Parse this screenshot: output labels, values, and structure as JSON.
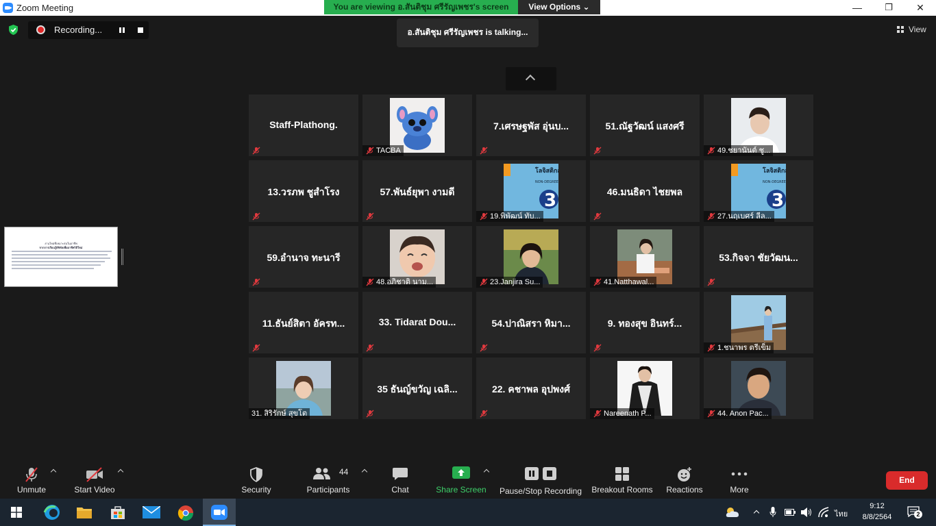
{
  "window": {
    "title": "Zoom Meeting",
    "minimize": "—",
    "restore": "❐",
    "close": "✕"
  },
  "share_banner": {
    "text": "You are viewing อ.สันติชุม ศรีรัญเพชร's screen",
    "view_options": "View Options ⌄"
  },
  "recording": {
    "label": "Recording..."
  },
  "talking": {
    "text": "อ.สันติชุม ศรีรัญเพชร is  talking..."
  },
  "view": {
    "label": "View"
  },
  "shared_screen": {
    "title_line1": "งานใหม่ที่เหมาะสมในอาชีพ",
    "title_line2": "จากการเรียนรู้ดิจิทัลเพื่ออาชีพวิถีใหม่"
  },
  "participants": [
    {
      "name": "Staff-Plathong.",
      "video": false
    },
    {
      "name": "TACBA",
      "video": true,
      "photo": "stitch-plush"
    },
    {
      "name": "7.เศรษฐพัส อุ่นบ...",
      "video": false
    },
    {
      "name": "51.ณัฐวัฒน์ แสงศรี",
      "video": false
    },
    {
      "name": "49.ชยานันต์ ชู...",
      "video": true,
      "photo": "person-white"
    },
    {
      "name": "13.วรภพ ชูสำโรง",
      "video": false
    },
    {
      "name": "57.พันธ์ยุพา งามดี",
      "video": false
    },
    {
      "name": "19.พิพัฒน์ ทับ...",
      "video": true,
      "photo": "course-banner"
    },
    {
      "name": "46.มนธิดา  ไชยพล",
      "video": false
    },
    {
      "name": "27.นฤเบศร์ ลีล...",
      "video": true,
      "photo": "course-banner"
    },
    {
      "name": "59.อำนาจ ทะนารี",
      "video": false
    },
    {
      "name": "48.อภิชาติ นาม...",
      "video": true,
      "photo": "baby"
    },
    {
      "name": "23.Janjira Su...",
      "video": true,
      "photo": "woman-trees"
    },
    {
      "name": "41.Natthawal...",
      "video": true,
      "photo": "woman-sofa"
    },
    {
      "name": "53.กิจจา ชัยวัฒน...",
      "video": false
    },
    {
      "name": "11.ธันย์สิตา อัครท...",
      "video": false
    },
    {
      "name": "33. Tidarat   Dou...",
      "video": false
    },
    {
      "name": "54.ปาณิสรา หิมา...",
      "video": false
    },
    {
      "name": "9. ทองสุข อินทร์...",
      "video": false
    },
    {
      "name": "1.ชนาพร  ตรีเข็ม",
      "video": true,
      "photo": "woman-bridge"
    },
    {
      "name": "31. สิริรักษ์ สุขโต",
      "video": true,
      "photo": "woman-road",
      "muted": false
    },
    {
      "name": "35 ธันญ์ขวัญ เฉลิ...",
      "video": false
    },
    {
      "name": "22. คชาพล อุปพงศ์",
      "video": false
    },
    {
      "name": "Nareenath P...",
      "video": true,
      "photo": "graduate"
    },
    {
      "name": "44. Anon Pac...",
      "video": true,
      "photo": "man-portrait"
    }
  ],
  "course_banner": {
    "line1": "โลจิสติกส์",
    "line2": "NON-DEGREE",
    "number": "3"
  },
  "toolbar": {
    "unmute": "Unmute",
    "start_video": "Start Video",
    "security": "Security",
    "participants": "Participants",
    "participants_count": "44",
    "chat": "Chat",
    "share_screen": "Share Screen",
    "pause_stop_recording": "Pause/Stop Recording",
    "breakout_rooms": "Breakout Rooms",
    "reactions": "Reactions",
    "more": "More",
    "end": "End"
  },
  "taskbar": {
    "time": "9:12",
    "date": "8/8/2564",
    "language": "ไทย",
    "notifications": "2"
  },
  "colors": {
    "accent_green": "#27ae4f",
    "end_red": "#d92b2b",
    "mic_off_red": "#e0393e",
    "tile_bg": "#262626"
  }
}
